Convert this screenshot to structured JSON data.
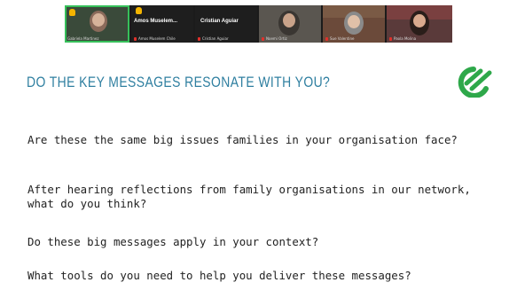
{
  "participants": [
    {
      "name": "Gabriela Martinez",
      "active": true,
      "hand_raised": true
    },
    {
      "name": "Amos Muselem Chile",
      "display": "Amos Muselem...",
      "hand_raised": true,
      "muted": true
    },
    {
      "name": "Cristian Aguiar",
      "display": "Cristian Aguiar",
      "muted": true
    },
    {
      "name": "Noemi Ortiz",
      "muted": true
    },
    {
      "name": "Sue Valentine",
      "muted": true
    },
    {
      "name": "Paola Molina",
      "muted": true
    }
  ],
  "slide": {
    "heading": "Do the key messages resonate with you?",
    "questions": [
      "Are these the same big issues families in your organisation face?",
      "After hearing reflections from family organisations in our network, what do you think?",
      "Do these big messages apply in your context?",
      "What tools do you need to help you deliver these messages?"
    ]
  },
  "colors": {
    "heading": "#2f7fa0",
    "logo_green": "#2ea84a",
    "active_border": "#36c05a",
    "hand": "#f4b400",
    "muted_mic": "#e0302b"
  },
  "icons": [
    "raised-hand-icon",
    "muted-mic-icon",
    "organisation-logo"
  ]
}
